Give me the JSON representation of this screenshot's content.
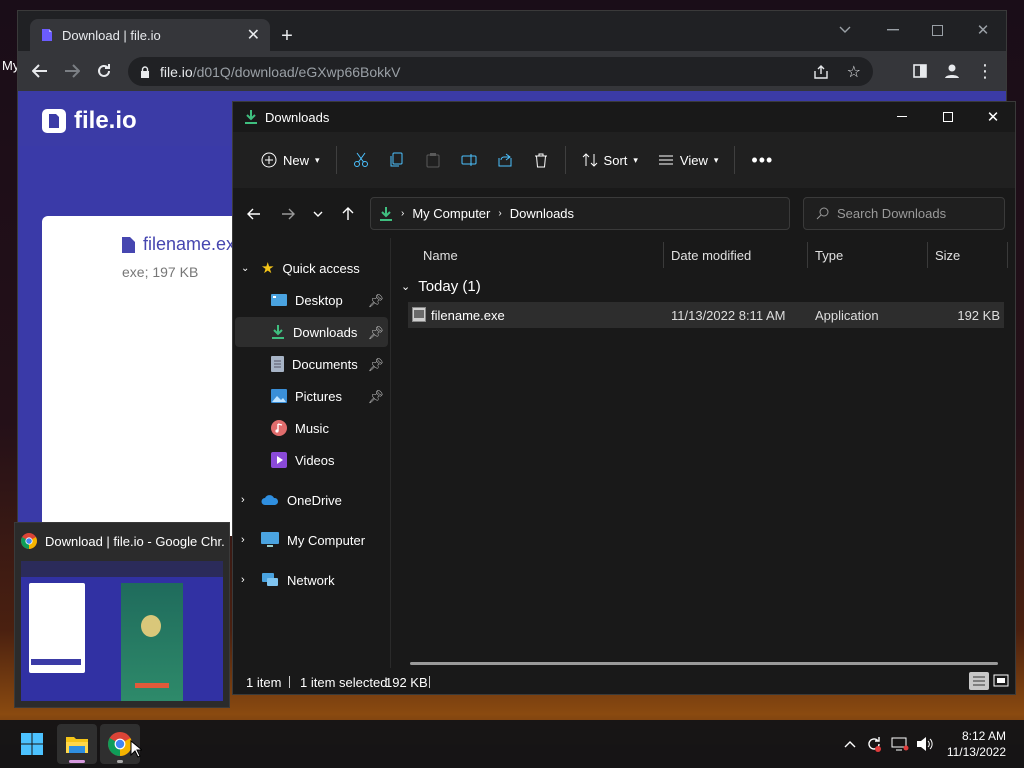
{
  "desktop": {
    "partial_label": "My"
  },
  "chrome": {
    "tab_title": "Download | file.io",
    "url_host": "file.io",
    "url_path": "/d01Q/download/eGXwp66BokkV",
    "page": {
      "logo_text": "file.io",
      "file_name": "filename.exe",
      "file_meta": "exe; 197 KB"
    }
  },
  "explorer": {
    "window_title": "Downloads",
    "toolbar": {
      "new_label": "New",
      "sort_label": "Sort",
      "view_label": "View"
    },
    "breadcrumb": [
      "My Computer",
      "Downloads"
    ],
    "search_placeholder": "Search Downloads",
    "sidebar": {
      "quick_access": "Quick access",
      "items": [
        {
          "label": "Desktop",
          "icon": "desktop-icon"
        },
        {
          "label": "Downloads",
          "icon": "downloads-icon"
        },
        {
          "label": "Documents",
          "icon": "documents-icon"
        },
        {
          "label": "Pictures",
          "icon": "pictures-icon"
        },
        {
          "label": "Music",
          "icon": "music-icon"
        },
        {
          "label": "Videos",
          "icon": "videos-icon"
        }
      ],
      "onedrive": "OneDrive",
      "my_computer": "My Computer",
      "network": "Network"
    },
    "columns": {
      "name": "Name",
      "date": "Date modified",
      "type": "Type",
      "size": "Size"
    },
    "group_label": "Today (1)",
    "files": [
      {
        "name": "filename.exe",
        "date": "11/13/2022 8:11 AM",
        "type": "Application",
        "size": "192 KB"
      }
    ],
    "status": {
      "count": "1 item",
      "selection": "1 item selected",
      "selection_size": "192 KB"
    }
  },
  "taskbar_preview": {
    "title": "Download | file.io - Google Chr..."
  },
  "taskbar": {
    "time": "8:12 AM",
    "date": "11/13/2022"
  },
  "colors": {
    "accent": "#4cc2ff",
    "download_green": "#3fbf7f",
    "fileio_purple": "#3b3ba6"
  }
}
